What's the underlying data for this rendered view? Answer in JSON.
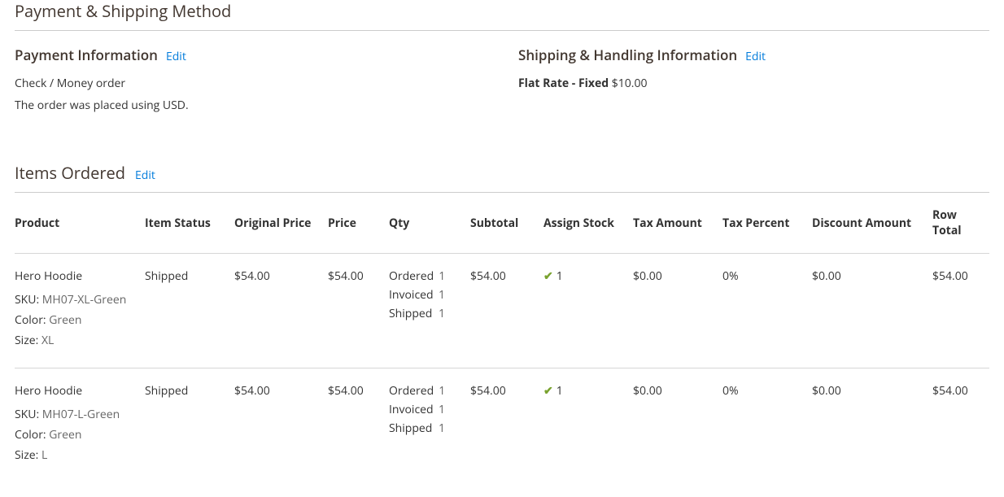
{
  "sections": {
    "payship_title": "Payment & Shipping Method",
    "payment": {
      "heading": "Payment Information",
      "edit": "Edit",
      "method": "Check / Money order",
      "currency_note": "The order was placed using USD."
    },
    "shipping": {
      "heading": "Shipping & Handling Information",
      "edit": "Edit",
      "method_label": "Flat Rate - Fixed",
      "amount": "$10.00"
    }
  },
  "items_section": {
    "title": "Items Ordered",
    "edit": "Edit"
  },
  "columns": {
    "product": "Product",
    "status": "Item Status",
    "oprice": "Original Price",
    "price": "Price",
    "qty": "Qty",
    "subtotal": "Subtotal",
    "assign": "Assign Stock",
    "tax": "Tax Amount",
    "taxp": "Tax Percent",
    "disc": "Discount Amount",
    "rowtotal": "Row Total"
  },
  "attr_labels": {
    "sku": "SKU:",
    "color": "Color:",
    "size": "Size:"
  },
  "qty_labels": {
    "ordered": "Ordered",
    "invoiced": "Invoiced",
    "shipped": "Shipped"
  },
  "items": [
    {
      "name": "Hero Hoodie",
      "sku": "MH07-XL-Green",
      "color": "Green",
      "size": "XL",
      "status": "Shipped",
      "original_price": "$54.00",
      "price": "$54.00",
      "qty": {
        "ordered": "1",
        "invoiced": "1",
        "shipped": "1"
      },
      "subtotal": "$54.00",
      "assign_stock": "1",
      "tax_amount": "$0.00",
      "tax_percent": "0%",
      "discount": "$0.00",
      "row_total": "$54.00"
    },
    {
      "name": "Hero Hoodie",
      "sku": "MH07-L-Green",
      "color": "Green",
      "size": "L",
      "status": "Shipped",
      "original_price": "$54.00",
      "price": "$54.00",
      "qty": {
        "ordered": "1",
        "invoiced": "1",
        "shipped": "1"
      },
      "subtotal": "$54.00",
      "assign_stock": "1",
      "tax_amount": "$0.00",
      "tax_percent": "0%",
      "discount": "$0.00",
      "row_total": "$54.00"
    }
  ]
}
